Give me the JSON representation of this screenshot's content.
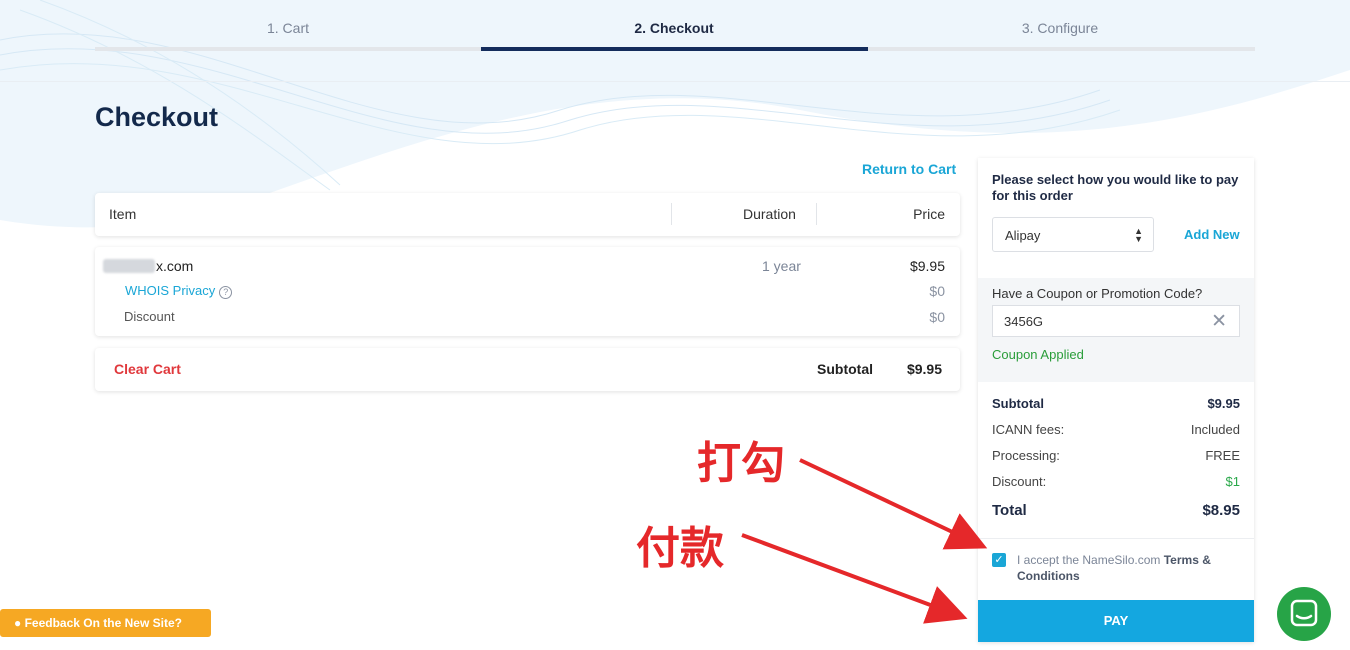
{
  "steps": [
    {
      "label": "1. Cart"
    },
    {
      "label": "2. Checkout"
    },
    {
      "label": "3. Configure"
    }
  ],
  "page_title": "Checkout",
  "return_link": "Return to Cart",
  "table_header": {
    "item": "Item",
    "duration": "Duration",
    "price": "Price"
  },
  "cart_item": {
    "domain_suffix": "x.com",
    "duration": "1 year",
    "price": "$9.95",
    "whois_label": "WHOIS Privacy",
    "whois_price": "$0",
    "discount_label": "Discount",
    "discount_price": "$0"
  },
  "totals_bar": {
    "clear_cart": "Clear Cart",
    "subtotal_label": "Subtotal",
    "subtotal_value": "$9.95"
  },
  "payment": {
    "prompt": "Please select how you would like to pay for this order",
    "method": "Alipay",
    "add_new": "Add New",
    "coupon_label": "Have a Coupon or Promotion Code?",
    "coupon_code": "3456G",
    "coupon_status": "Coupon Applied"
  },
  "summary": {
    "subtotal_label": "Subtotal",
    "subtotal_value": "$9.95",
    "icann_label": "ICANN fees:",
    "icann_value": "Included",
    "processing_label": "Processing:",
    "processing_value": "FREE",
    "discount_label": "Discount:",
    "discount_value": "$1",
    "total_label": "Total",
    "total_value": "$8.95"
  },
  "terms": {
    "prefix": "I accept the NameSilo.com ",
    "link": "Terms & Conditions"
  },
  "pay_button": "PAY",
  "annotations": {
    "check": "打勾",
    "pay": "付款"
  },
  "feedback_button": "Feedback On the New Site?",
  "colors": {
    "accent": "#14a7e0",
    "annotation": "#e5282a",
    "navy": "#13294b"
  }
}
